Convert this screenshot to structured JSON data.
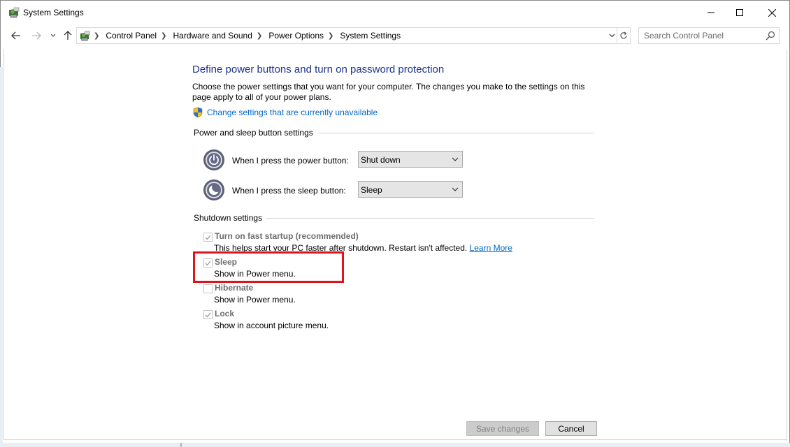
{
  "window": {
    "title": "System Settings",
    "icon": "control-panel-icon"
  },
  "navigation": {
    "back_icon": "arrow-left-icon",
    "forward_icon": "arrow-right-icon",
    "recent_icon": "chevron-down-icon",
    "up_icon": "arrow-up-icon",
    "breadcrumbs": [
      "Control Panel",
      "Hardware and Sound",
      "Power Options",
      "System Settings"
    ],
    "search_placeholder": "Search Control Panel"
  },
  "main": {
    "title": "Define power buttons and turn on password protection",
    "description": "Choose the power settings that you want for your computer. The changes you make to the settings on this page apply to all of your power plans.",
    "change_link": "Change settings that are currently unavailable",
    "power_section": {
      "heading": "Power and sleep button settings",
      "rows": [
        {
          "label": "When I press the power button:",
          "value": "Shut down",
          "icon": "power-button-icon"
        },
        {
          "label": "When I press the sleep button:",
          "value": "Sleep",
          "icon": "sleep-button-icon"
        }
      ]
    },
    "shutdown_section": {
      "heading": "Shutdown settings",
      "items": [
        {
          "title": "Turn on fast startup (recommended)",
          "desc": "This helps start your PC faster after shutdown. Restart isn't affected.",
          "link": "Learn More",
          "checked": true
        },
        {
          "title": "Sleep",
          "desc": "Show in Power menu.",
          "checked": true
        },
        {
          "title": "Hibernate",
          "desc": "Show in Power menu.",
          "checked": false
        },
        {
          "title": "Lock",
          "desc": "Show in account picture menu.",
          "checked": true
        }
      ]
    }
  },
  "footer": {
    "save_label": "Save changes",
    "cancel_label": "Cancel"
  },
  "colors": {
    "title_blue": "#1e3287",
    "link_blue": "#0066cc",
    "highlight_red": "#e0131d"
  }
}
